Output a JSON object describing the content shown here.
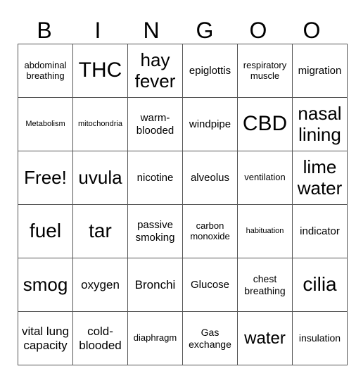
{
  "header": [
    "B",
    "I",
    "N",
    "G",
    "O",
    "O"
  ],
  "rows": [
    [
      {
        "text": "abdominal breathing",
        "size": "s10"
      },
      {
        "text": "THC",
        "size": "s26"
      },
      {
        "text": "hay fever",
        "size": "s22"
      },
      {
        "text": "epiglottis",
        "size": "s12"
      },
      {
        "text": "respiratory muscle",
        "size": "s10"
      },
      {
        "text": "migration",
        "size": "s12"
      }
    ],
    [
      {
        "text": "Metabolism",
        "size": "s9"
      },
      {
        "text": "mitochondria",
        "size": "s9"
      },
      {
        "text": "warm-blooded",
        "size": "s12"
      },
      {
        "text": "windpipe",
        "size": "s12"
      },
      {
        "text": "CBD",
        "size": "s26"
      },
      {
        "text": "nasal lining",
        "size": "s22"
      }
    ],
    [
      {
        "text": "Free!",
        "size": "s22"
      },
      {
        "text": "uvula",
        "size": "s22"
      },
      {
        "text": "nicotine",
        "size": "s12"
      },
      {
        "text": "alveolus",
        "size": "s12"
      },
      {
        "text": "ventilation",
        "size": "s10"
      },
      {
        "text": "lime water",
        "size": "s22"
      }
    ],
    [
      {
        "text": "fuel",
        "size": "s24"
      },
      {
        "text": "tar",
        "size": "s24"
      },
      {
        "text": "passive smoking",
        "size": "s12"
      },
      {
        "text": "carbon monoxide",
        "size": "s10"
      },
      {
        "text": "habituation",
        "size": "s9"
      },
      {
        "text": "indicator",
        "size": "s12"
      }
    ],
    [
      {
        "text": "smog",
        "size": "s22"
      },
      {
        "text": "oxygen",
        "size": "s13"
      },
      {
        "text": "Bronchi",
        "size": "s13"
      },
      {
        "text": "Glucose",
        "size": "s12"
      },
      {
        "text": "chest breathing",
        "size": "s11"
      },
      {
        "text": "cilia",
        "size": "s24"
      }
    ],
    [
      {
        "text": "vital lung capacity",
        "size": "s13"
      },
      {
        "text": "cold-blooded",
        "size": "s13"
      },
      {
        "text": "diaphragm",
        "size": "s10"
      },
      {
        "text": "Gas exchange",
        "size": "s11"
      },
      {
        "text": "water",
        "size": "s20"
      },
      {
        "text": "insulation",
        "size": "s11"
      }
    ]
  ]
}
